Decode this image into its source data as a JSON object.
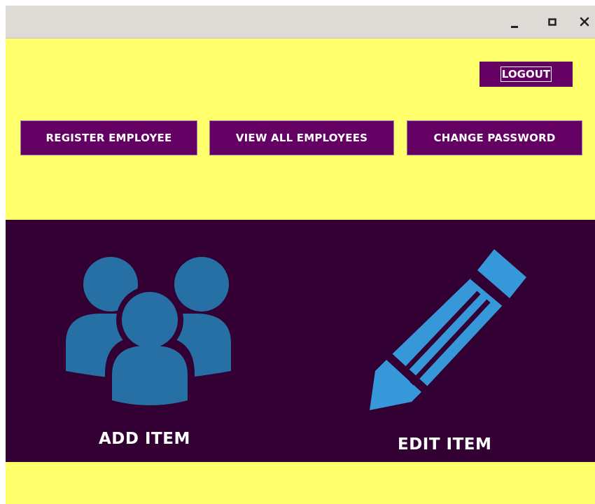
{
  "window": {
    "controls": [
      "minimize-icon",
      "maximize-icon",
      "close-icon"
    ]
  },
  "header": {
    "logout_label": "LOGOUT"
  },
  "nav": {
    "register_employee": "REGISTER EMPLOYEE",
    "view_all_employees": "VIEW ALL EMPLOYEES",
    "change_password": "CHANGE PASSWORD"
  },
  "tiles": {
    "add_item": {
      "label": "ADD ITEM",
      "icon": "users-group-icon"
    },
    "edit_item": {
      "label": "EDIT ITEM",
      "icon": "pencil-icon"
    }
  },
  "colors": {
    "background_yellow": "#ffff6b",
    "button_purple": "#640064",
    "panel_dark_purple": "#330033",
    "users_icon_blue": "#2670a6",
    "pencil_icon_blue": "#3698d8"
  }
}
